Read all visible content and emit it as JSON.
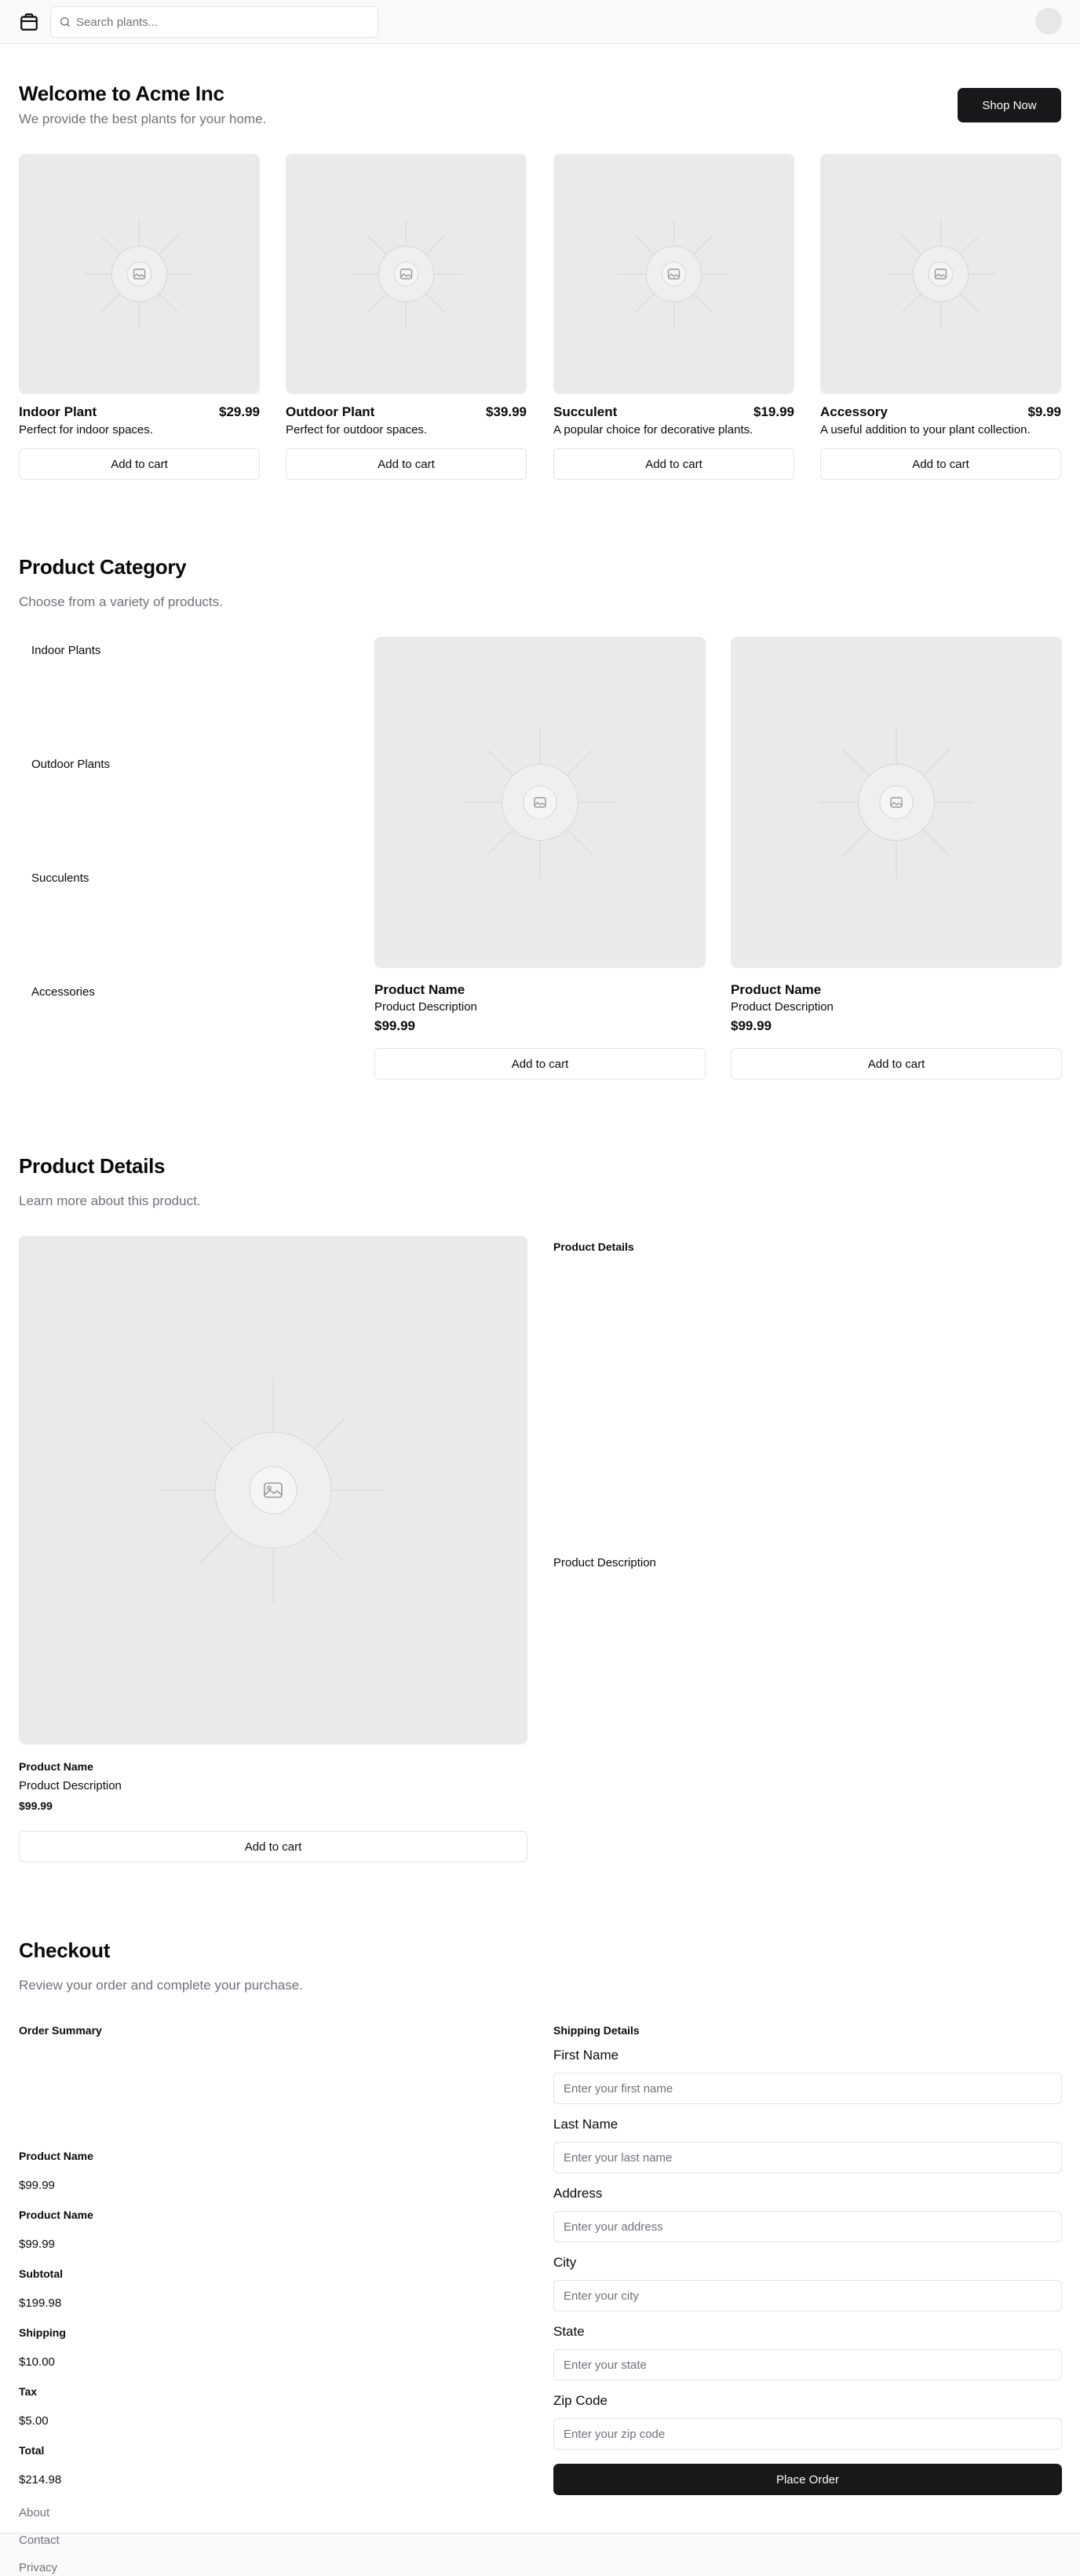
{
  "header": {
    "logo_icon": "package-icon",
    "search_icon": "search-icon",
    "search_placeholder": "Search plants...",
    "search_value": ""
  },
  "hero": {
    "title": "Welcome to Acme Inc",
    "subtitle": "We provide the best plants for your home.",
    "cta_label": "Shop Now"
  },
  "featured_products": [
    {
      "name": "Indoor Plant",
      "price": "$29.99",
      "description": "Perfect for indoor spaces.",
      "button": "Add to cart"
    },
    {
      "name": "Outdoor Plant",
      "price": "$39.99",
      "description": "Perfect for outdoor spaces.",
      "button": "Add to cart"
    },
    {
      "name": "Succulent",
      "price": "$19.99",
      "description": "A popular choice for decorative plants.",
      "button": "Add to cart"
    },
    {
      "name": "Accessory",
      "price": "$9.99",
      "description": "A useful addition to your plant collection.",
      "button": "Add to cart"
    }
  ],
  "category": {
    "title": "Product Category",
    "subtitle": "Choose from a variety of products.",
    "items": [
      "Indoor Plants",
      "Outdoor Plants",
      "Succulents",
      "Accessories"
    ],
    "products": [
      {
        "name": "Product Name",
        "description": "Product Description",
        "price": "$99.99",
        "button": "Add to cart"
      },
      {
        "name": "Product Name",
        "description": "Product Description",
        "price": "$99.99",
        "button": "Add to cart"
      }
    ]
  },
  "details": {
    "title": "Product Details",
    "subtitle": "Learn more about this product.",
    "product": {
      "name": "Product Name",
      "description": "Product Description",
      "price": "$99.99",
      "button": "Add to cart"
    },
    "side_heading": "Product Details",
    "side_description": "Product Description"
  },
  "checkout": {
    "title": "Checkout",
    "subtitle": "Review your order and complete your purchase.",
    "order_summary_label": "Order Summary",
    "lines": [
      {
        "label": "Product Name",
        "value": "$99.99"
      },
      {
        "label": "Product Name",
        "value": "$99.99"
      },
      {
        "label": "Subtotal",
        "value": "$199.98"
      },
      {
        "label": "Shipping",
        "value": "$10.00"
      },
      {
        "label": "Tax",
        "value": "$5.00"
      },
      {
        "label": "Total",
        "value": "$214.98"
      }
    ],
    "shipping_label": "Shipping Details",
    "fields": [
      {
        "label": "First Name",
        "placeholder": "Enter your first name"
      },
      {
        "label": "Last Name",
        "placeholder": "Enter your last name"
      },
      {
        "label": "Address",
        "placeholder": "Enter your address"
      },
      {
        "label": "City",
        "placeholder": "Enter your city"
      },
      {
        "label": "State",
        "placeholder": "Enter your state"
      },
      {
        "label": "Zip Code",
        "placeholder": "Enter your zip code"
      }
    ],
    "submit_label": "Place Order"
  },
  "footer": {
    "links": [
      "About",
      "Contact",
      "Privacy"
    ]
  },
  "colors": {
    "primary": "#18181b",
    "muted_text": "#71717a",
    "border": "#e4e4e7",
    "placeholder_bg": "#eaeaea"
  }
}
